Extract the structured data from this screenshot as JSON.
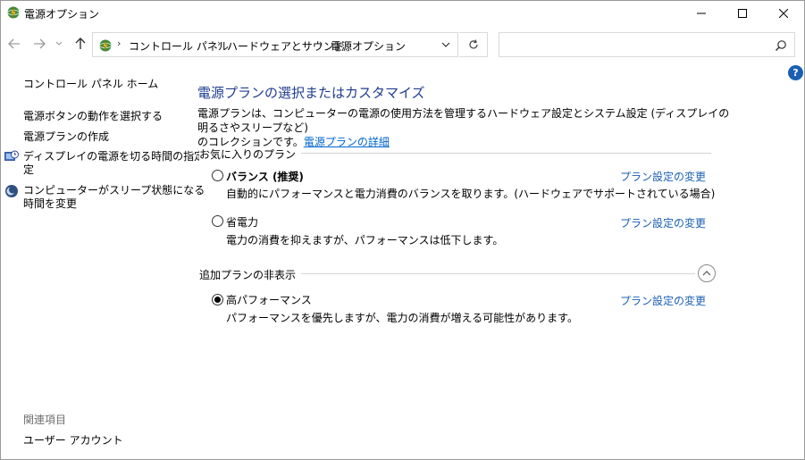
{
  "window": {
    "title": "電源オプション"
  },
  "address": {
    "crumbs": [
      "コントロール パネル",
      "ハードウェアとサウンド",
      "電源オプション"
    ]
  },
  "search": {
    "placeholder": ""
  },
  "sidebar": {
    "home": "コントロール パネル ホーム",
    "items": [
      {
        "label": "電源ボタンの動作を選択する"
      },
      {
        "label": "電源プランの作成"
      },
      {
        "label": "ディスプレイの電源を切る時間の指定",
        "line2": "定"
      },
      {
        "label": "コンピューターがスリープ状態になる",
        "line2": "時間を変更"
      }
    ],
    "related_heading": "関連項目",
    "related_link": "ユーザー アカウント"
  },
  "main": {
    "heading": "電源プランの選択またはカスタマイズ",
    "desc_line1": "電源プランは、コンピューターの電源の使用方法を管理するハードウェア設定とシステム設定 (ディスプレイの明るさやスリープなど)",
    "desc_line2_prefix": "のコレクションです。",
    "desc_link": "電源プランの詳細",
    "favorites_label": "お気に入りのプラン",
    "hidden_label": "追加プランの非表示",
    "change_link": "プラン設定の変更",
    "plans": [
      {
        "name": "バランス (推奨)",
        "desc": "自動的にパフォーマンスと電力消費のバランスを取ります。(ハードウェアでサポートされている場合)",
        "selected": false
      },
      {
        "name": "省電力",
        "desc": "電力の消費を抑えますが、パフォーマンスは低下します。",
        "selected": false
      },
      {
        "name": "高パフォーマンス",
        "desc": "パフォーマンスを優先しますが、電力の消費が増える可能性があります。",
        "selected": true
      }
    ]
  },
  "colors": {
    "heading": "#1e3e8f",
    "link": "#1a5fb4",
    "help": "#1a5fb4"
  }
}
